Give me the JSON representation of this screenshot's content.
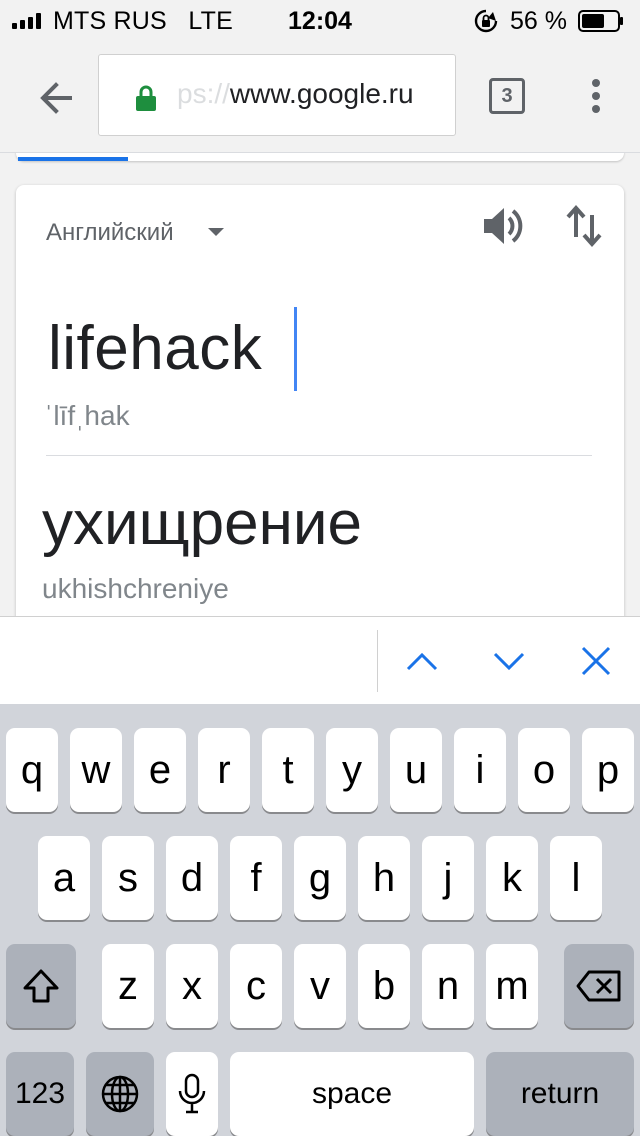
{
  "status_bar": {
    "carrier": "MTS RUS",
    "network": "LTE",
    "time": "12:04",
    "battery_percent": "56 %"
  },
  "browser": {
    "url_faded": "ps://",
    "url_main": "www.google.ru",
    "tab_count": "3"
  },
  "translator": {
    "source_language": "Английский",
    "source_text": "lifehack",
    "source_transliteration": "ˈlīfˌhak",
    "target_text": "ухищрение",
    "target_transliteration": "ukhishchreniye"
  },
  "keyboard": {
    "row1": [
      "q",
      "w",
      "e",
      "r",
      "t",
      "y",
      "u",
      "i",
      "o",
      "p"
    ],
    "row2": [
      "a",
      "s",
      "d",
      "f",
      "g",
      "h",
      "j",
      "k",
      "l"
    ],
    "row3": [
      "z",
      "x",
      "c",
      "v",
      "b",
      "n",
      "m"
    ],
    "numbers_label": "123",
    "space_label": "space",
    "return_label": "return"
  },
  "colors": {
    "accent_blue": "#4285f4",
    "lock_green": "#1e8e3e",
    "find_icon_blue": "#1a73e8"
  },
  "icons": {
    "back": "arrow-left-icon",
    "secure": "lock-icon",
    "menu": "more-vert-icon",
    "speaker": "speaker-icon",
    "swap": "swap-vertical-icon",
    "up": "chevron-up-icon",
    "down": "chevron-down-icon",
    "close": "close-icon",
    "shift": "shift-icon",
    "delete": "backspace-icon",
    "globe": "globe-icon",
    "mic": "microphone-icon"
  }
}
